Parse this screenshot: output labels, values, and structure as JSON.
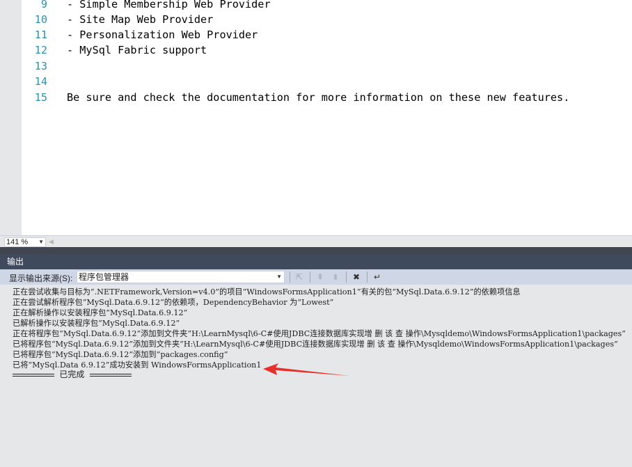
{
  "editor": {
    "lines": [
      {
        "num": "9",
        "text": "- Simple Membership Web Provider"
      },
      {
        "num": "10",
        "text": "- Site Map Web Provider"
      },
      {
        "num": "11",
        "text": "- Personalization Web Provider"
      },
      {
        "num": "12",
        "text": "- MySql Fabric support"
      },
      {
        "num": "13",
        "text": ""
      },
      {
        "num": "14",
        "text": ""
      },
      {
        "num": "15",
        "text": "Be sure and check the documentation for more information on these new features."
      }
    ],
    "zoom": "141 %"
  },
  "output": {
    "title": "输出",
    "source_label": "显示输出来源(S):",
    "source_value": "程序包管理器",
    "lines": [
      "正在尝试收集与目标为“.NETFramework,Version=v4.0”的项目“WindowsFormsApplication1”有关的包“MySql.Data.6.9.12”的依赖项信息",
      "正在尝试解析程序包“MySql.Data.6.9.12”的依赖项，DependencyBehavior 为“Lowest”",
      "正在解析操作以安装程序包“MySql.Data.6.9.12”",
      "已解析操作以安装程序包“MySql.Data.6.9.12”",
      "正在将程序包“MySql.Data.6.9.12”添加到文件夹“H:\\LearnMysql\\6-C#使用JDBC连接数据库实现增 删 该 查 操作\\Mysqldemo\\WindowsFormsApplication1\\packages”",
      "已将程序包“MySql.Data.6.9.12”添加到文件夹“H:\\LearnMysql\\6-C#使用JDBC连接数据库实现增 删 该 查 操作\\Mysqldemo\\WindowsFormsApplication1\\packages”",
      "已将程序包“MySql.Data.6.9.12”添加到“packages.config”",
      "已将“MySql.Data 6.9.12”成功安装到 WindowsFormsApplication1"
    ],
    "done": "已完成"
  },
  "colors": {
    "annotation_arrow": "#e8302a"
  }
}
